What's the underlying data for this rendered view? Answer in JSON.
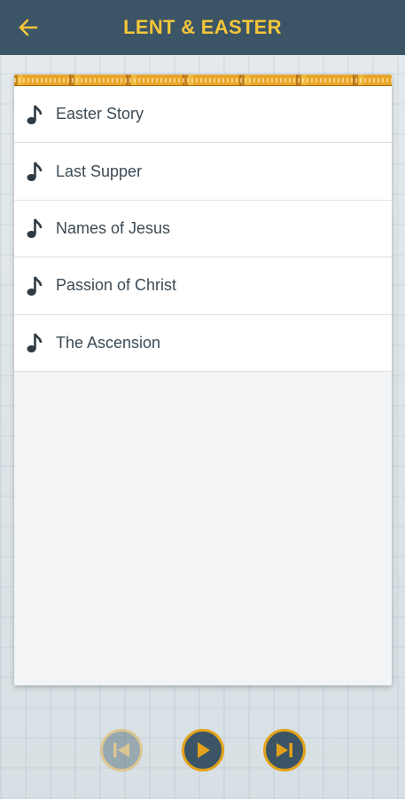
{
  "header": {
    "title": "LENT & EASTER",
    "back_icon": "arrow-left-icon"
  },
  "colors": {
    "appbar": "#3b5566",
    "accent": "#f5c63a",
    "control_ring": "#e3a219"
  },
  "songs": [
    {
      "label": "Easter Story",
      "icon": "music-note-icon"
    },
    {
      "label": "Last Supper",
      "icon": "music-note-icon"
    },
    {
      "label": "Names of Jesus",
      "icon": "music-note-icon"
    },
    {
      "label": "Passion of Christ",
      "icon": "music-note-icon"
    },
    {
      "label": "The Ascension",
      "icon": "music-note-icon"
    }
  ],
  "player": {
    "previous_icon": "skip-previous-icon",
    "previous_enabled": false,
    "play_icon": "play-icon",
    "next_icon": "skip-next-icon"
  }
}
